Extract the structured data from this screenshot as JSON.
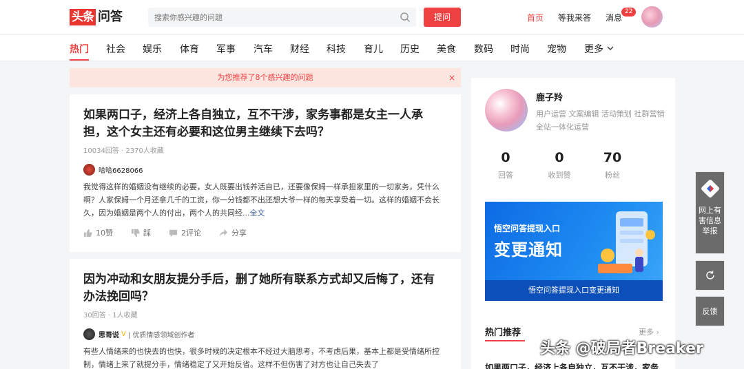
{
  "header": {
    "logo_box": "头条",
    "logo_text": "问答",
    "search_placeholder": "搜索你感兴趣的问题",
    "ask_label": "提问",
    "nav": [
      "首页",
      "等我来答",
      "消息"
    ],
    "msg_count": "22"
  },
  "categories": [
    "热门",
    "社会",
    "娱乐",
    "体育",
    "军事",
    "汽车",
    "财经",
    "科技",
    "育儿",
    "历史",
    "美食",
    "数码",
    "时尚",
    "宠物",
    "更多"
  ],
  "notice": {
    "text": "为您推荐了8个感兴趣的问题",
    "close": "×"
  },
  "questions": [
    {
      "title": "如果两口子，经济上各自独立，互不干涉，家务事都是女主一人承担，这个女主还有必要和这位男主继续下去吗？",
      "answers": "10034回答",
      "favorites": "2370人收藏",
      "author": "哈哈6628066",
      "excerpt": "我觉得这样的婚姻没有继续的必要，女人既要出钱养活自已，还要像保姆一样承担家里的一切家务，凭什么啊？人家保姆一个月还拿几千的工资，你一分钱都不出还想大爷一样的每天享受着一切。这样的婚姻不会长久，因为婚姻是两个人的付出，两个人的共同经...",
      "more": "全文",
      "likes": "10赞",
      "dislike": "踩",
      "comments": "2评论",
      "share": "分享"
    },
    {
      "title": "因为冲动和女朋友提分手后，删了她所有联系方式却又后悔了，还有办法挽回吗？",
      "answers": "30回答",
      "favorites": "1人收藏",
      "author": "思哥说",
      "author_tag": "| 优质情感领域创作者",
      "excerpt": "有些人情绪来的也快去的也快，很多时候的决定根本不经过大脑思考，不考虑后果，基本上都是受情绪所控制，情绪上来了就提分手，情绪稳定了又开始反省。这样不但伤害了对方也让自己失去了"
    }
  ],
  "profile": {
    "name": "鹿子羚",
    "desc": "用户运营 文案编辑 活动策划 社群营销 全站一体化运营",
    "stats": [
      {
        "num": "0",
        "label": "回答"
      },
      {
        "num": "0",
        "label": "收到赞"
      },
      {
        "num": "70",
        "label": "粉丝"
      }
    ]
  },
  "banner": {
    "line1": "悟空问答提现入口",
    "line2": "变更通知",
    "bar": "悟空问答提现入口变更通知"
  },
  "hot": {
    "title": "热门推荐",
    "more": "更多",
    "first_item": "如果两口子，经济上各自独立，互不干涉，家务"
  },
  "floating": {
    "report": "网上有害信息举报",
    "feedback": "反馈"
  },
  "watermark": "头条 @破局者Breaker",
  "colors": {
    "accent": "#f04142",
    "banner_blue": "#1f8df2"
  }
}
